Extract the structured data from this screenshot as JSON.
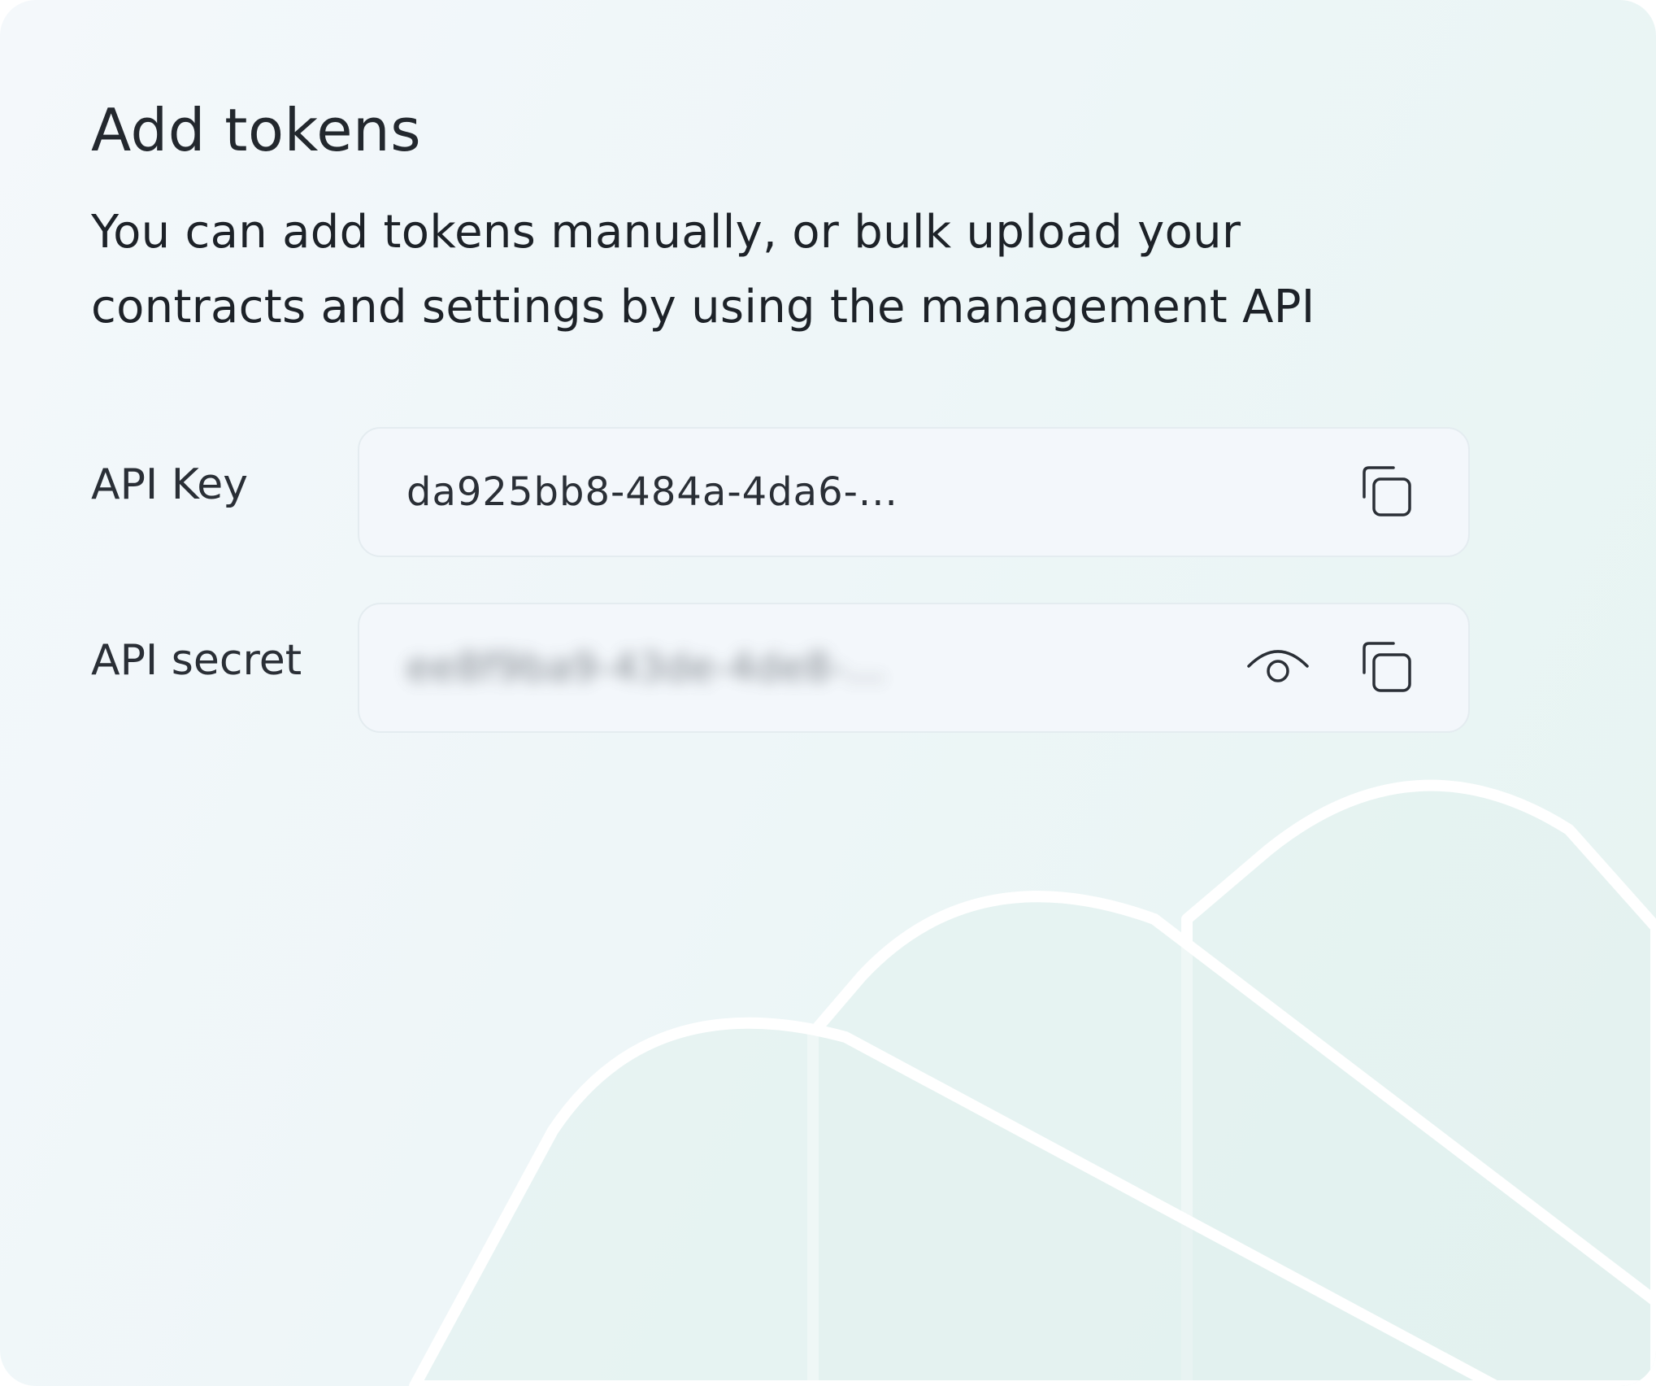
{
  "title": "Add tokens",
  "subtitle": "You can add tokens manually, or bulk upload your contracts and settings by using the management API",
  "fields": {
    "api_key": {
      "label": "API Key",
      "value": "da925bb8-484a-4da6-..."
    },
    "api_secret": {
      "label": "API secret",
      "value": "ee8f9ba9-43de-4de8-..."
    }
  },
  "icons": {
    "copy": "copy-icon",
    "reveal": "eye-icon"
  },
  "colors": {
    "background_start": "#f4f8fb",
    "background_end": "#e6f4f1",
    "field_background": "#f3f7fb",
    "text": "#1f242b"
  }
}
